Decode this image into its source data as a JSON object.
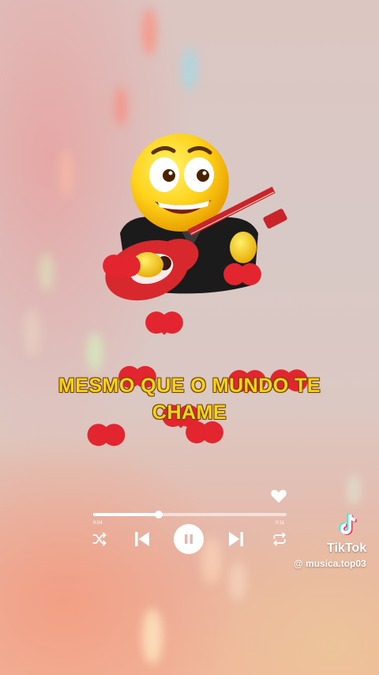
{
  "lyrics": {
    "line1": "MESMO QUE O MUNDO TE",
    "line2": "CHAME"
  },
  "player": {
    "time_current": "0:04",
    "time_total": "0:11",
    "progress": 0.34,
    "state": "playing"
  },
  "icons": {
    "favorite": "heart-outline-icon",
    "shuffle": "shuffle-icon",
    "previous": "skip-previous-icon",
    "pause": "pause-icon",
    "next": "skip-next-icon",
    "repeat": "repeat-icon"
  },
  "watermark": {
    "brand": "TikTok",
    "username": "@ musica.top03"
  },
  "colors": {
    "lyrics_text": "#f7d21c",
    "hearts": "#e3252f",
    "controls": "#ffffff"
  }
}
